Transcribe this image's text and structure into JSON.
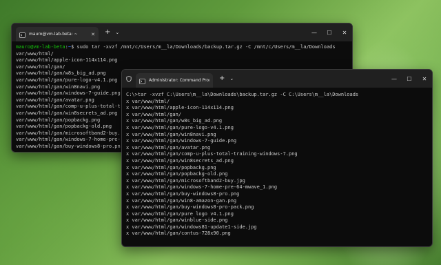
{
  "window_back": {
    "tab_title": "mauro@vm-lab-beta: ~",
    "prompt_user": "mauro@vm-lab-beta",
    "prompt_sep": ":",
    "prompt_path": "~",
    "prompt_symbol": "$ ",
    "command": "sudo tar -xvzf /mnt/c/Users/m__la/Downloads/backup.tar.gz -C /mnt/c/Users/m__la/Downloads",
    "lines": [
      "var/www/html/",
      "var/www/html/apple-icon-114x114.png",
      "var/www/html/gan/",
      "var/www/html/gan/w8s_big_ad.png",
      "var/www/html/gan/pure-logo-v4.1.png",
      "var/www/html/gan/win8navi.png",
      "var/www/html/gan/windows-7-guide.png",
      "var/www/html/gan/avatar.png",
      "var/www/html/gan/comp-u-plus-total-t",
      "var/www/html/gan/win8secrets_ad.png",
      "var/www/html/gan/popbackg.png",
      "var/www/html/gan/popbackg-old.png",
      "var/www/html/gan/microsoftband2-buy.",
      "var/www/html/gan/windows-7-home-pre-",
      "var/www/html/gan/buy-windows8-pro.pn"
    ]
  },
  "window_front": {
    "tab_title": "Administrator: Command Prom",
    "new_tab": "+",
    "dropdown": "⌄",
    "prompt": "C:\\>",
    "command": "tar -xvzf C:\\Users\\m__la\\Downloads\\backup.tar.gz -C C:\\Users\\m__la\\Downloads",
    "lines": [
      "x var/www/html/",
      "x var/www/html/apple-icon-114x114.png",
      "x var/www/html/gan/",
      "x var/www/html/gan/w8s_big_ad.png",
      "x var/www/html/gan/pure-logo-v4.1.png",
      "x var/www/html/gan/win8navi.png",
      "x var/www/html/gan/windows-7-guide.png",
      "x var/www/html/gan/avatar.png",
      "x var/www/html/gan/comp-u-plus-total-training-windows-7.png",
      "x var/www/html/gan/win8secrets_ad.png",
      "x var/www/html/gan/popbackg.png",
      "x var/www/html/gan/popbackg-old.png",
      "x var/www/html/gan/microsoftband2-buy.jpg",
      "x var/www/html/gan/windows-7-home-pre-64-mwave_1.png",
      "x var/www/html/gan/buy-windows8-pro.png",
      "x var/www/html/gan/win8-amazon-gan.png",
      "x var/www/html/gan/buy-windows8-pro-pack.png",
      "x var/www/html/gan/pure logo v4.1.png",
      "x var/www/html/gan/winblue-side.png",
      "x var/www/html/gan/windows81-update1-side.jpg",
      "x var/www/html/gan/contus-728x90.png"
    ]
  },
  "controls": {
    "new_tab": "+",
    "dropdown": "⌄",
    "minimize": "—",
    "maximize": "☐",
    "close": "✕",
    "tab_close": "✕"
  }
}
